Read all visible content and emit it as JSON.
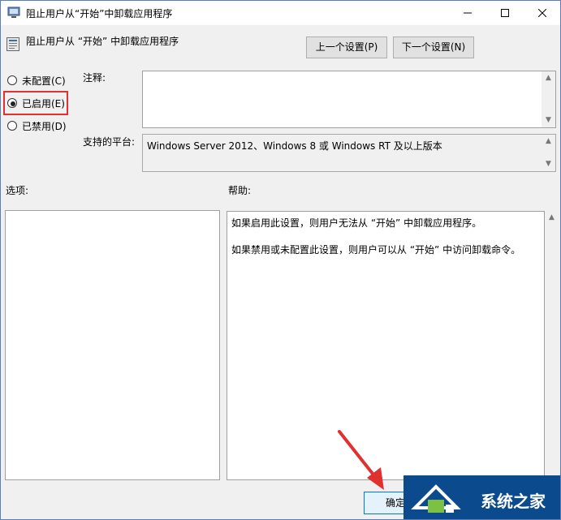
{
  "window": {
    "title": "阻止用户从“开始”中卸载应用程序",
    "controls": {
      "minimize": "—",
      "maximize": "☐",
      "close": "✕"
    }
  },
  "policy": {
    "name": "阻止用户从 “开始” 中卸载应用程序",
    "prev_button": "上一个设置(P)",
    "next_button": "下一个设置(N)"
  },
  "state": {
    "options": [
      {
        "label": "未配置(C)",
        "selected": false
      },
      {
        "label": "已启用(E)",
        "selected": true
      },
      {
        "label": "已禁用(D)",
        "selected": false
      }
    ]
  },
  "comment": {
    "label": "注释:",
    "value": ""
  },
  "platform": {
    "label": "支持的平台:",
    "value": "Windows Server 2012、Windows 8 或 Windows RT 及以上版本"
  },
  "options_section": {
    "label": "选项:"
  },
  "help_section": {
    "label": "帮助:",
    "paragraphs": [
      "如果启用此设置，则用户无法从 “开始” 中卸载应用程序。",
      "如果禁用或未配置此设置，则用户可以从 “开始” 中访问卸载命令。"
    ]
  },
  "footer": {
    "ok_button": "确定"
  },
  "watermark": {
    "text": "系统之家"
  },
  "colors": {
    "highlight": "#e03131",
    "arrow": "#e03131",
    "watermark_bg": "#0b4a8c"
  }
}
